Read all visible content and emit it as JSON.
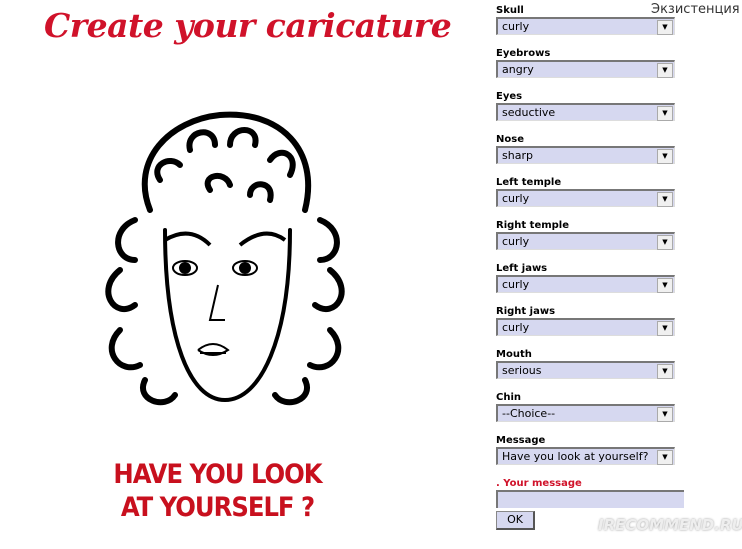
{
  "title": "Create your caricature",
  "corner_text": "Экзистенция",
  "message_image_text": "HAVE YOU LOOK AT YOURSELF ?",
  "fields": [
    {
      "label": "Skull",
      "value": "curly"
    },
    {
      "label": "Eyebrows",
      "value": "angry"
    },
    {
      "label": "Eyes",
      "value": "seductive"
    },
    {
      "label": "Nose",
      "value": "sharp"
    },
    {
      "label": "Left temple",
      "value": "curly"
    },
    {
      "label": "Right temple",
      "value": "curly"
    },
    {
      "label": "Left jaws",
      "value": "curly"
    },
    {
      "label": "Right jaws",
      "value": "curly"
    },
    {
      "label": "Mouth",
      "value": "serious"
    },
    {
      "label": "Chin",
      "value": "--Choice--"
    },
    {
      "label": "Message",
      "value": "Have you look at yourself?"
    }
  ],
  "your_message_label": ". Your message",
  "your_message_value": "",
  "ok_label": "OK",
  "watermark": "IRECOMMEND.RU",
  "colors": {
    "accent": "#d0122a",
    "field_bg": "#d6d8f0"
  }
}
